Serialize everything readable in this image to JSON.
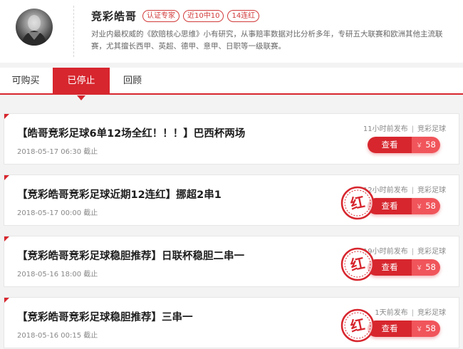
{
  "expert": {
    "name": "竞彩皓哥",
    "badges": [
      "认证专家",
      "近10中10",
      "14连红"
    ],
    "bio": "对业内最权威的《欧赔核心思维》小有研究，从事赔率数据对比分析多年，专研五大联赛和欧洲其他主流联赛，尤其擅长西甲、英超、德甲、意甲、日职等一级联赛。"
  },
  "tabs": [
    {
      "label": "可购买"
    },
    {
      "label": "已停止",
      "active": true
    },
    {
      "label": "回顾"
    }
  ],
  "articles": [
    {
      "title": "【皓哥竞彩足球6单12场全红！！！】巴西杯两场",
      "deadline": "2018-05-17 06:30 截止",
      "published": "11小时前发布",
      "category": "竞彩足球",
      "button": "查看",
      "currency": "￥",
      "price": "58",
      "stamp": null
    },
    {
      "title": "【竞彩皓哥竞彩足球近期12连红】挪超2串1",
      "deadline": "2018-05-17 00:00 截止",
      "published": "12小时前发布",
      "category": "竞彩足球",
      "button": "查看",
      "currency": "￥",
      "price": "58",
      "stamp": "红"
    },
    {
      "title": "【竞彩皓哥竞彩足球稳胆推荐】日联杯稳胆二串一",
      "deadline": "2018-05-16 18:00 截止",
      "published": "19小时前发布",
      "category": "竞彩足球",
      "button": "查看",
      "currency": "￥",
      "price": "58",
      "stamp": "红"
    },
    {
      "title": "【竞彩皓哥竞彩足球稳胆推荐】三串一",
      "deadline": "2018-05-16 00:15 截止",
      "published": "1天前发布",
      "category": "竞彩足球",
      "button": "查看",
      "currency": "￥",
      "price": "58",
      "stamp": "红"
    }
  ],
  "colors": {
    "accent": "#d7262e",
    "price_bg": "#f0555b"
  },
  "icons": {
    "stamp": "red-hit-stamp-icon",
    "avatar": "expert-avatar-photo"
  }
}
